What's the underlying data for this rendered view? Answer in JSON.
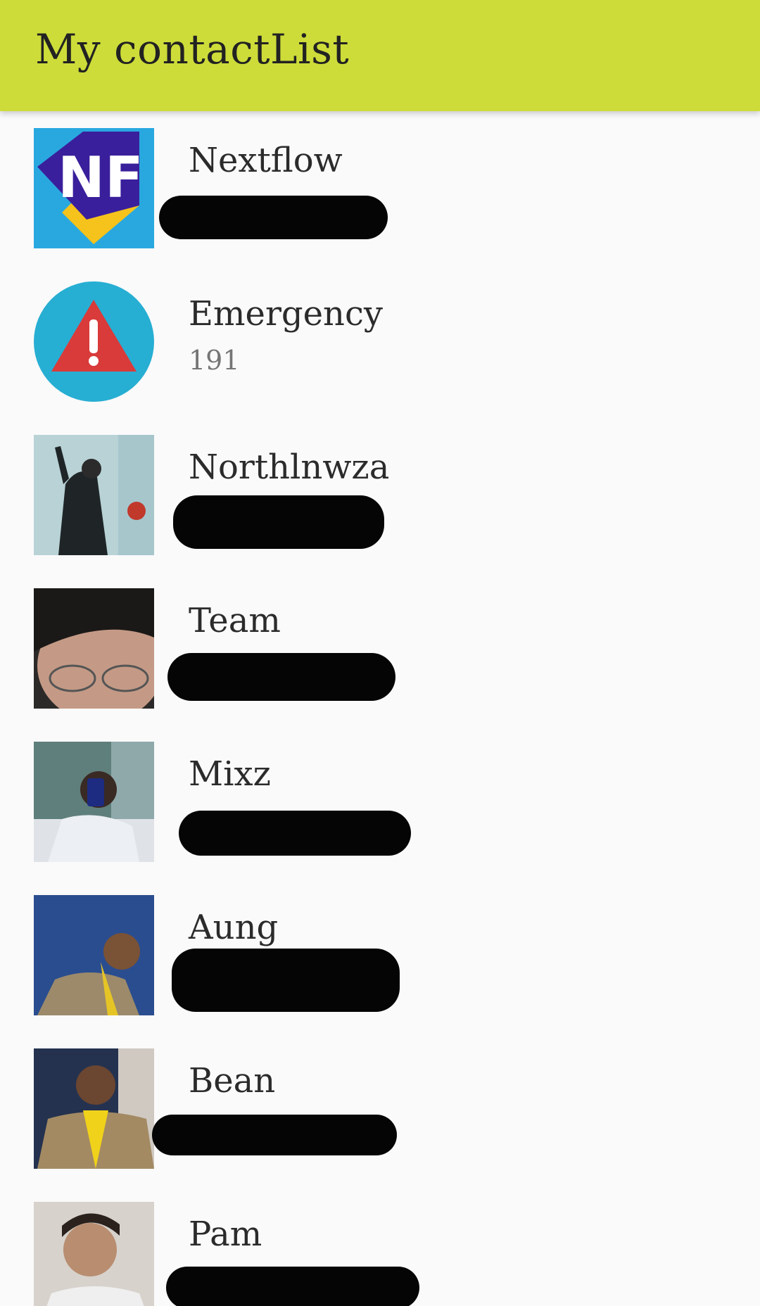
{
  "appbar": {
    "title": "My contactList",
    "color": "#cddc39"
  },
  "contacts": [
    {
      "name": "Nextflow",
      "phone": "",
      "avatar": "nf-logo"
    },
    {
      "name": "Emergency",
      "phone": "191",
      "avatar": "warning-icon"
    },
    {
      "name": "Northlnwza",
      "phone": "",
      "avatar": "photo"
    },
    {
      "name": "Team",
      "phone": "",
      "avatar": "photo"
    },
    {
      "name": "Mixz",
      "phone": "",
      "avatar": "photo"
    },
    {
      "name": "Aung",
      "phone": "",
      "avatar": "photo"
    },
    {
      "name": "Bean",
      "phone": "",
      "avatar": "photo"
    },
    {
      "name": "Pam",
      "phone": "",
      "avatar": "photo"
    }
  ]
}
